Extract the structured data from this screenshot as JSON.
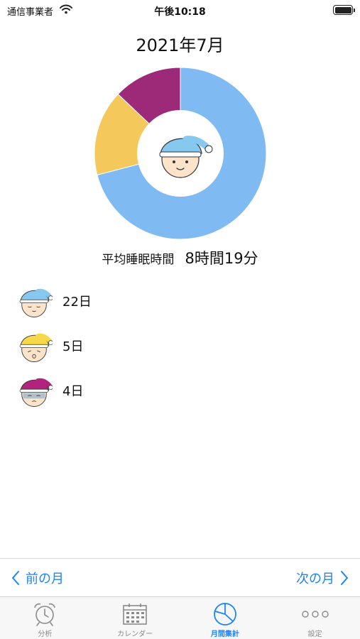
{
  "status_bar": {
    "carrier": "通信事業者",
    "time": "午後10:18"
  },
  "month_title": "2021年7月",
  "chart_data": {
    "type": "pie",
    "variant": "donut",
    "categories": [
      "blue-cap face",
      "yellow-cap face",
      "purple-cap face"
    ],
    "values": [
      22,
      5,
      4
    ],
    "colors": [
      "#7fbaf2",
      "#f4c85a",
      "#9c2a78"
    ]
  },
  "average": {
    "label": "平均睡眠時間",
    "value": "8時間19分"
  },
  "summary": [
    {
      "icon": "blue-cap-sleep-face-icon",
      "cap_color": "#86c8f0",
      "count": "22日"
    },
    {
      "icon": "yellow-cap-sleep-face-icon",
      "cap_color": "#f6d84a",
      "count": "5日"
    },
    {
      "icon": "purple-cap-sleep-face-icon",
      "cap_color": "#b2237f",
      "count": "4日"
    }
  ],
  "nav": {
    "prev": "前の月",
    "next": "次の月"
  },
  "tabs": [
    {
      "label": "分析",
      "icon": "alarm-clock-icon"
    },
    {
      "label": "カレンダー",
      "icon": "calendar-icon"
    },
    {
      "label": "月間集計",
      "icon": "pie-chart-icon"
    },
    {
      "label": "設定",
      "icon": "more-dots-icon"
    }
  ],
  "accent_color": "#1a84ff"
}
